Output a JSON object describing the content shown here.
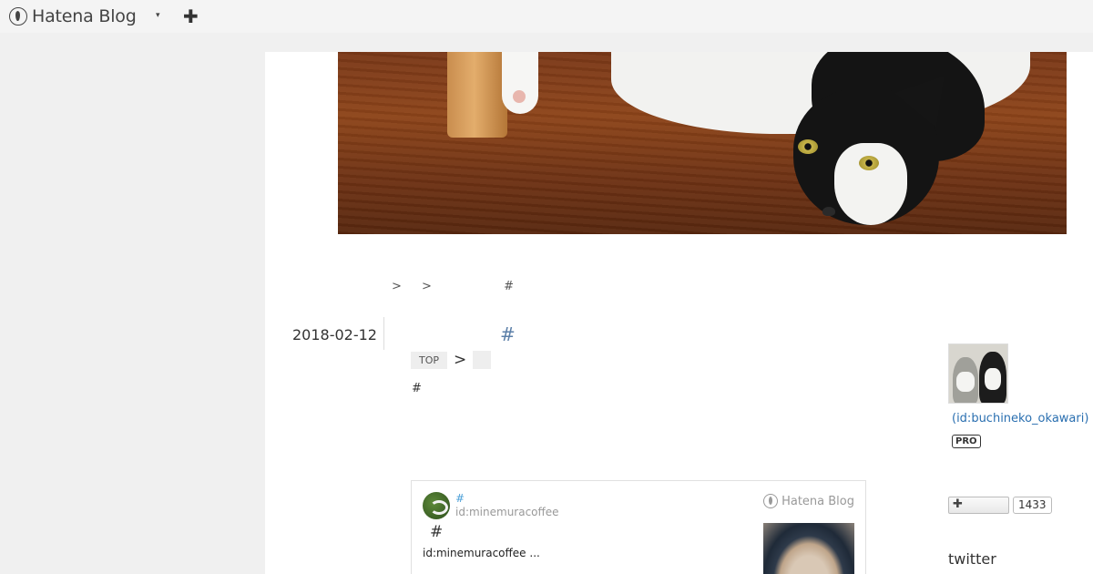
{
  "topbar": {
    "brand": "Hatena Blog",
    "menu_caret": "▾",
    "add_label": "✚"
  },
  "header_image": {
    "alt_description_icon": "cat-photo"
  },
  "breadcrumb_line": {
    "sep1": ">",
    "sep2": ">",
    "hash": "#"
  },
  "entry": {
    "date": "2018-02-12",
    "title_hash": "#",
    "category_top": "TOP",
    "category_sep": ">",
    "body_hash": "#"
  },
  "embed_card": {
    "hash": "#",
    "user": "id:minemuracoffee",
    "brand": "Hatena Blog",
    "title": "#",
    "description": "id:minemuracoffee ..."
  },
  "sidebar": {
    "profile_id": "(id:buchineko_okawari)",
    "pro_badge": "PRO",
    "follow_label": "✚",
    "follow_count": "1433",
    "twitter_label": "twitter"
  }
}
